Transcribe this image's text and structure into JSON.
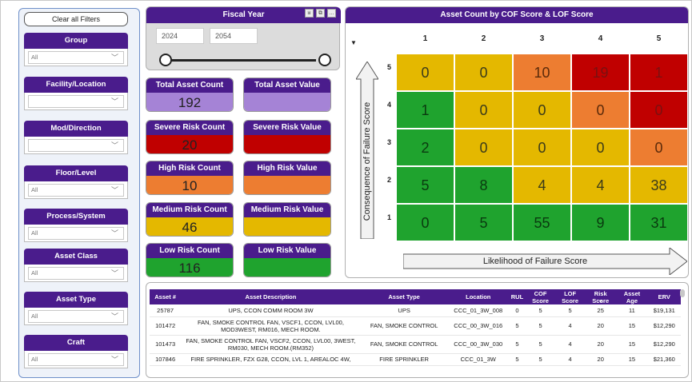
{
  "filters": {
    "clear_label": "Clear all Filters",
    "items": [
      {
        "label": "Group",
        "value": "All"
      },
      {
        "label": "Facility/Location",
        "value": ""
      },
      {
        "label": "Mod/Direction",
        "value": ""
      },
      {
        "label": "Floor/Level",
        "value": "All"
      },
      {
        "label": "Process/System",
        "value": "All"
      },
      {
        "label": "Asset Class",
        "value": "All"
      },
      {
        "label": "Asset Type",
        "value": "All"
      },
      {
        "label": "Craft",
        "value": "All"
      }
    ]
  },
  "fiscal_year": {
    "title": "Fiscal Year",
    "start": "2024",
    "end": "2054",
    "tools": [
      "filter-icon",
      "focus-icon",
      "more-icon"
    ]
  },
  "kpis": [
    {
      "title": "Total Asset Count",
      "value": "192",
      "color": "#a583d6"
    },
    {
      "title": "Total Asset Value",
      "value": "",
      "color": "#a583d6"
    },
    {
      "title": "Severe Risk Count",
      "value": "20",
      "color": "#c00000"
    },
    {
      "title": "Severe Risk Value",
      "value": "",
      "color": "#c00000"
    },
    {
      "title": "High Risk Count",
      "value": "10",
      "color": "#ed7d31"
    },
    {
      "title": "High Risk Value",
      "value": "",
      "color": "#ed7d31"
    },
    {
      "title": "Medium Risk Count",
      "value": "46",
      "color": "#e4b800"
    },
    {
      "title": "Medium Risk Value",
      "value": "",
      "color": "#e4b800"
    },
    {
      "title": "Low Risk Count",
      "value": "116",
      "color": "#1fa32e"
    },
    {
      "title": "Low Risk Value",
      "value": "",
      "color": "#1fa32e"
    }
  ],
  "heatmap": {
    "title": "Asset Count by COF Score & LOF Score",
    "columns": [
      "1",
      "2",
      "3",
      "4",
      "5"
    ],
    "rows": [
      "5",
      "4",
      "3",
      "2",
      "1"
    ],
    "y_axis_label": "Consequence of Failure Score",
    "x_axis_label": "Likelihood of Failure Score",
    "colors": {
      "low": "#1fa32e",
      "medium": "#e4b800",
      "high": "#ed7d31",
      "severe": "#c00000"
    },
    "cells": [
      [
        {
          "v": "0",
          "level": "medium"
        },
        {
          "v": "0",
          "level": "medium"
        },
        {
          "v": "10",
          "level": "high"
        },
        {
          "v": "19",
          "level": "severe"
        },
        {
          "v": "1",
          "level": "severe"
        }
      ],
      [
        {
          "v": "1",
          "level": "low"
        },
        {
          "v": "0",
          "level": "medium"
        },
        {
          "v": "0",
          "level": "medium"
        },
        {
          "v": "0",
          "level": "high"
        },
        {
          "v": "0",
          "level": "severe"
        }
      ],
      [
        {
          "v": "2",
          "level": "low"
        },
        {
          "v": "0",
          "level": "medium"
        },
        {
          "v": "0",
          "level": "medium"
        },
        {
          "v": "0",
          "level": "medium"
        },
        {
          "v": "0",
          "level": "high"
        }
      ],
      [
        {
          "v": "5",
          "level": "low"
        },
        {
          "v": "8",
          "level": "low"
        },
        {
          "v": "4",
          "level": "medium"
        },
        {
          "v": "4",
          "level": "medium"
        },
        {
          "v": "38",
          "level": "medium"
        }
      ],
      [
        {
          "v": "0",
          "level": "low"
        },
        {
          "v": "5",
          "level": "low"
        },
        {
          "v": "55",
          "level": "low"
        },
        {
          "v": "9",
          "level": "low"
        },
        {
          "v": "31",
          "level": "low"
        }
      ]
    ]
  },
  "table": {
    "headers": [
      "Asset #",
      "Asset Description",
      "Asset Type",
      "Location",
      "RUL",
      "COF Score",
      "LOF Score",
      "Risk Score",
      "Asset Age",
      "ERV"
    ],
    "rows": [
      [
        "25787",
        "UPS, CCON COMM ROOM 3W",
        "UPS",
        "CCC_01_3W_008",
        "0",
        "5",
        "5",
        "25",
        "11",
        "$19,131"
      ],
      [
        "101472",
        "FAN, SMOKE CONTROL FAN, VSCF1, CCON, LVL00, MOD3WEST, RM016, MECH ROOM.",
        "FAN, SMOKE CONTROL",
        "CCC_00_3W_016",
        "5",
        "5",
        "4",
        "20",
        "15",
        "$12,290"
      ],
      [
        "101473",
        "FAN, SMOKE CONTROL FAN, VSCF2, CCON, LVL00, 3WEST, RM030, MECH ROOM.(RM352)",
        "FAN, SMOKE CONTROL",
        "CCC_00_3W_030",
        "5",
        "5",
        "4",
        "20",
        "15",
        "$12,290"
      ],
      [
        "107846",
        "FIRE SPRINKLER, FZX G28, CCON, LVL 1, AREALOC 4W,",
        "FIRE SPRINKLER",
        "CCC_01_3W",
        "5",
        "5",
        "4",
        "20",
        "15",
        "$21,360"
      ]
    ]
  }
}
